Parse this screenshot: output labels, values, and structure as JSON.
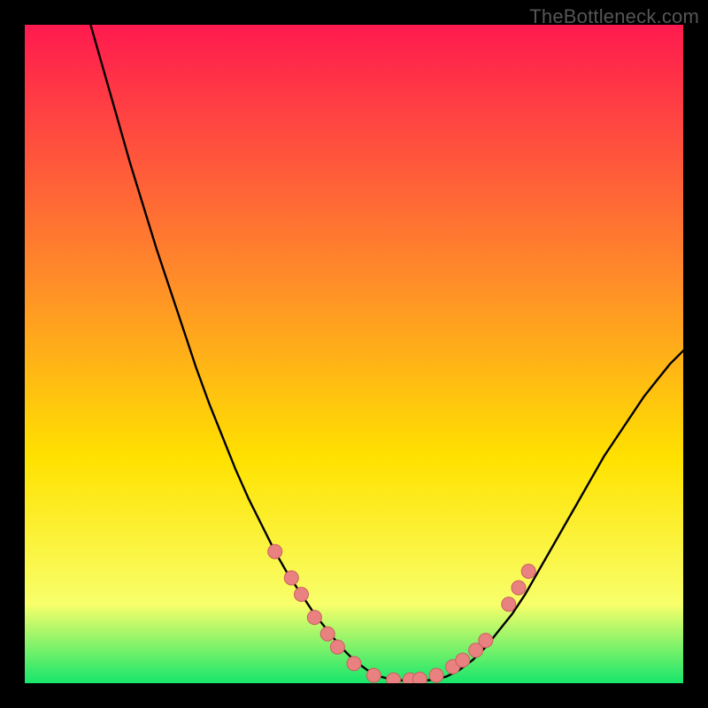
{
  "watermark": "TheBottleneck.com",
  "colors": {
    "bg": "#000000",
    "grad_top": "#ff1a4f",
    "grad_mid1": "#ff8a2a",
    "grad_mid2": "#ffe200",
    "grad_low": "#f8ff6a",
    "grad_bottom": "#17e66b",
    "curve": "#000000",
    "marker_fill": "#e98180",
    "marker_stroke": "#c9605f"
  },
  "chart_data": {
    "type": "line",
    "title": "",
    "xlabel": "",
    "ylabel": "",
    "xlim": [
      0,
      100
    ],
    "ylim": [
      0,
      100
    ],
    "series": [
      {
        "name": "bottleneck-curve",
        "x": [
          10,
          12,
          14,
          16,
          18,
          20,
          22,
          24,
          26,
          28,
          30,
          32,
          34,
          36,
          38,
          40,
          42,
          44,
          46,
          48,
          50,
          52,
          54,
          56,
          58,
          60,
          62,
          64,
          66,
          68,
          70,
          72,
          74,
          76,
          78,
          80,
          82,
          84,
          86,
          88,
          90,
          92,
          94,
          96,
          98,
          100
        ],
        "y": [
          100,
          93,
          86,
          79,
          72.5,
          66,
          60,
          54,
          48,
          42.5,
          37.5,
          32.5,
          28,
          24,
          20,
          16.5,
          13.5,
          10.5,
          8,
          5.5,
          3.5,
          2,
          1,
          0.5,
          0.4,
          0.4,
          0.5,
          1,
          2,
          3.5,
          5.5,
          8,
          10.5,
          13.5,
          17,
          20.5,
          24,
          27.5,
          31,
          34.5,
          37.5,
          40.5,
          43.5,
          46,
          48.5,
          50.5
        ]
      }
    ],
    "markers": {
      "name": "highlighted-points",
      "x": [
        38,
        40.5,
        42,
        44,
        46,
        47.5,
        50,
        53,
        56,
        58.5,
        60,
        62.5,
        65,
        66.5,
        68.5,
        70,
        73.5,
        75,
        76.5
      ],
      "y": [
        20,
        16,
        13.5,
        10,
        7.5,
        5.5,
        3,
        1.2,
        0.5,
        0.5,
        0.6,
        1.2,
        2.5,
        3.5,
        5,
        6.5,
        12,
        14.5,
        17
      ]
    },
    "axes_visible": false,
    "grid": false
  }
}
